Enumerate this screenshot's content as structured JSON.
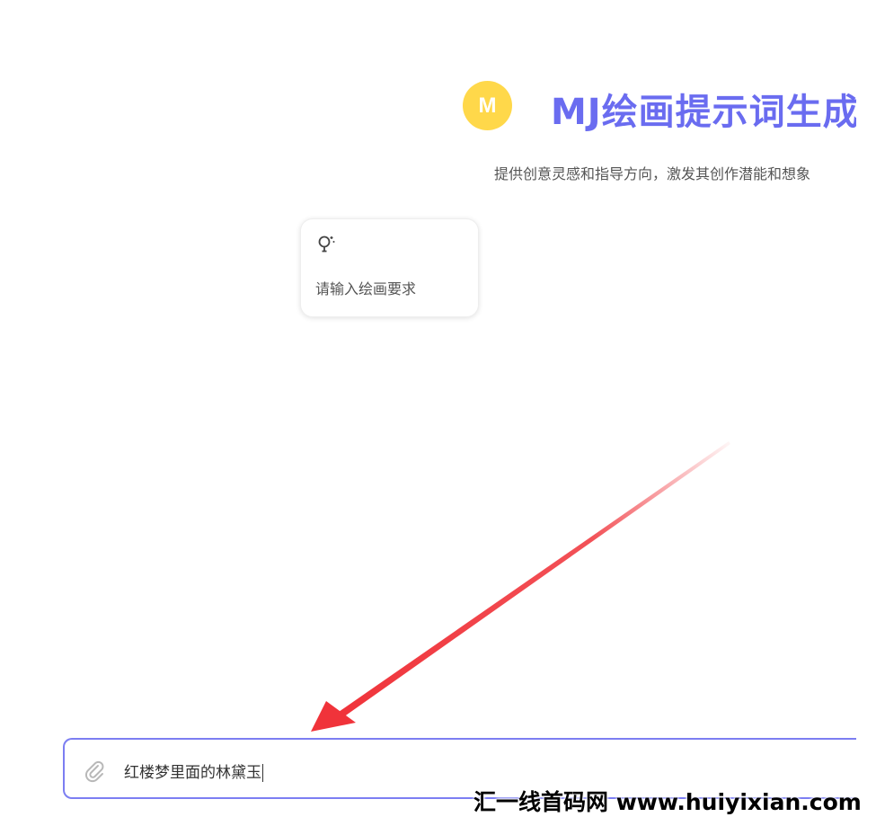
{
  "header": {
    "avatar_letter": "M",
    "title": "MJ绘画提示词生成",
    "subtitle": "提供创意灵感和指导方向，激发其创作潜能和想象"
  },
  "suggestion_card": {
    "icon": "lightbulb-icon",
    "text": "请输入绘画要求"
  },
  "input_bar": {
    "value": "红楼梦里面的林黛玉",
    "attach_icon": "paperclip-icon"
  },
  "watermark": {
    "text": "汇一线首码网 www.huiyixian.com"
  },
  "colors": {
    "accent": "#6a6cf0",
    "avatar_bg": "#ffd84a",
    "arrow": "#f0333a",
    "input_border": "#7c7ef2"
  }
}
